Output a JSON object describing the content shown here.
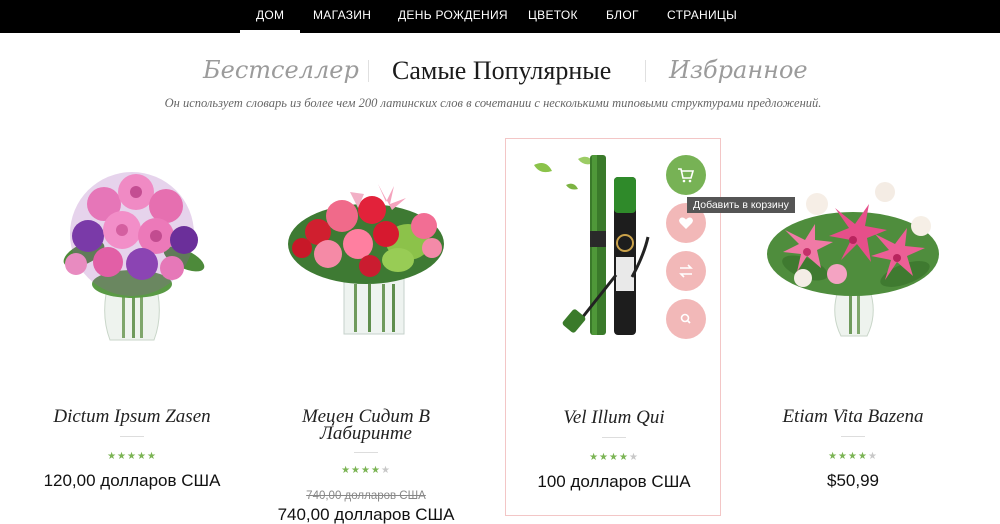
{
  "nav": {
    "items": [
      {
        "label": "Дом",
        "active": true
      },
      {
        "label": "Магазин",
        "active": false
      },
      {
        "label": "День рождения",
        "active": false
      },
      {
        "label": "Цветок",
        "active": false
      },
      {
        "label": "Блог",
        "active": false
      },
      {
        "label": "Страницы",
        "active": false
      }
    ]
  },
  "tabs": [
    {
      "label": "Бестселлер",
      "active": false
    },
    {
      "label": "Самые Популярные",
      "active": true
    },
    {
      "label": "Избранное",
      "active": false
    }
  ],
  "subtitle": "Он использует словарь из более чем 200 латинских слов в сочетании с несколькими типовыми структурами предложений.",
  "products": [
    {
      "name": "Dictum Ipsum Zasen",
      "rating": 5,
      "price": "120,00 долларов США",
      "old_price": null,
      "image": "pink-purple-flower-bouquet"
    },
    {
      "name": "Мецен Сидит В Лабиринте",
      "rating": 4.5,
      "price": "740,00 долларов США",
      "old_price": "740,00 долларов США",
      "image": "red-pink-roses-in-glass-vase"
    },
    {
      "name": "Vel Illum Qui",
      "rating": 4,
      "price": "100 долларов США",
      "old_price": null,
      "image": "green-mascara-set"
    },
    {
      "name": "Etiam Vita Bazena",
      "rating": 4,
      "price": "$50,99",
      "old_price": null,
      "image": "pink-lily-bouquet"
    }
  ],
  "hover_actions": {
    "tooltip": "Добавить в корзину",
    "icons": [
      "cart-icon",
      "heart-icon",
      "compare-icon",
      "search-icon"
    ]
  },
  "colors": {
    "nav_bg": "#000000",
    "cart_green": "#77b255",
    "action_pink": "#f2b8b8",
    "star_green": "#7bb454",
    "card_border": "#f3c6c6"
  }
}
